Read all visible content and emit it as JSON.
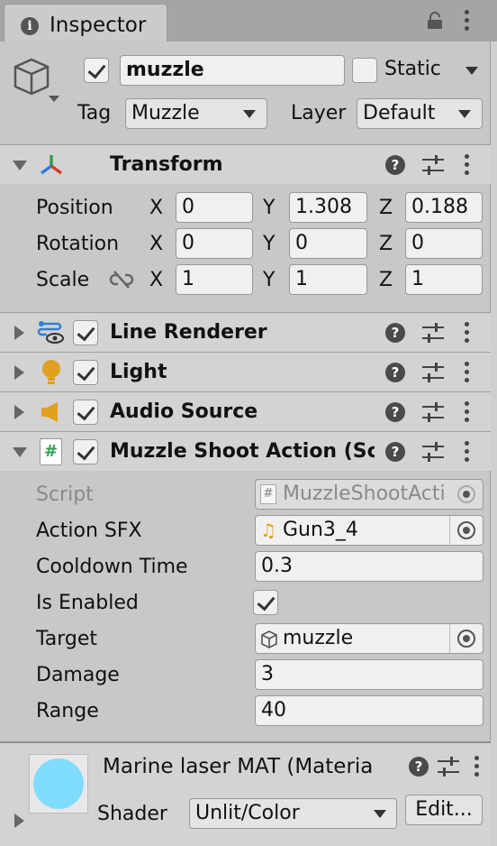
{
  "window": {
    "tab_title": "Inspector",
    "tab_icon": "info-icon"
  },
  "gameobject": {
    "active": true,
    "name": "muzzle",
    "static_label": "Static",
    "static_checked": false,
    "tag_label": "Tag",
    "tag_value": "Muzzle",
    "layer_label": "Layer",
    "layer_value": "Default"
  },
  "transform": {
    "title": "Transform",
    "rows": [
      {
        "label": "Position",
        "x": "0",
        "y": "1.308",
        "z": "0.188"
      },
      {
        "label": "Rotation",
        "x": "0",
        "y": "0",
        "z": "0"
      },
      {
        "label": "Scale",
        "x": "1",
        "y": "1",
        "z": "1"
      }
    ],
    "axis_x": "X",
    "axis_y": "Y",
    "axis_z": "Z"
  },
  "components": [
    {
      "title": "Line Renderer",
      "enabled": true,
      "icon": "line-renderer-icon"
    },
    {
      "title": "Light",
      "enabled": true,
      "icon": "light-bulb-icon"
    },
    {
      "title": "Audio Source",
      "enabled": true,
      "icon": "speaker-icon"
    }
  ],
  "script_component": {
    "title": "Muzzle Shoot Action (Scr",
    "enabled": true,
    "icon": "script-icon",
    "fields": {
      "script_label": "Script",
      "script_value": "MuzzleShootActi",
      "sfx_label": "Action SFX",
      "sfx_value": "Gun3_4",
      "cooldown_label": "Cooldown Time",
      "cooldown_value": "0.3",
      "enabled_label": "Is Enabled",
      "enabled_value": true,
      "target_label": "Target",
      "target_value": "muzzle",
      "damage_label": "Damage",
      "damage_value": "3",
      "range_label": "Range",
      "range_value": "40"
    }
  },
  "material": {
    "title": "Marine laser MAT (Materia",
    "preview_color": "#80dcff",
    "shader_label": "Shader",
    "shader_value": "Unlit/Color",
    "edit_label": "Edit..."
  },
  "colors": {
    "accent_green": "#2e9d4a",
    "transform_red": "#d63a2f",
    "transform_blue": "#2f7fd6"
  }
}
